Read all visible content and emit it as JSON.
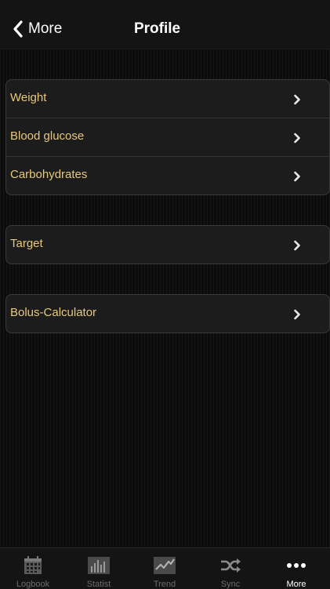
{
  "nav": {
    "back_label": "More",
    "title": "Profile"
  },
  "groups": [
    {
      "items": [
        {
          "label": "Weight"
        },
        {
          "label": "Blood glucose"
        },
        {
          "label": "Carbohydrates"
        }
      ]
    },
    {
      "items": [
        {
          "label": "Target"
        }
      ]
    },
    {
      "items": [
        {
          "label": "Bolus-Calculator"
        }
      ]
    }
  ],
  "tabs": [
    {
      "label": "Logbook",
      "icon": "calendar-icon",
      "active": false
    },
    {
      "label": "Statist",
      "icon": "bar-chart-icon",
      "active": false
    },
    {
      "label": "Trend",
      "icon": "trend-line-icon",
      "active": false
    },
    {
      "label": "Sync",
      "icon": "shuffle-icon",
      "active": false
    },
    {
      "label": "More",
      "icon": "more-dots-icon",
      "active": true
    }
  ],
  "colors": {
    "accent_label": "#e8c87c",
    "background": "#0b0b0b",
    "cell": "#1c1c1c",
    "tab_inactive": "#6d6d6d",
    "tab_active": "#ffffff"
  }
}
